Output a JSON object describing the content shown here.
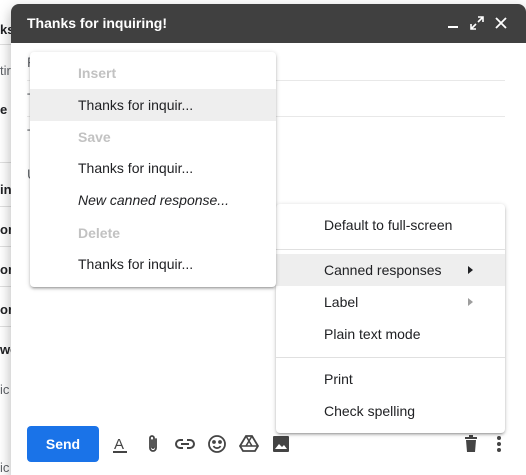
{
  "background": {
    "fragments": [
      "ks",
      "tir",
      "e",
      "in",
      "on",
      "on",
      "on",
      "we",
      "ic",
      "ic"
    ]
  },
  "compose": {
    "title": "Thanks for inquiring!",
    "field_fragments": [
      "F",
      "T",
      "T",
      "U"
    ],
    "send_label": "Send"
  },
  "canned_menu": {
    "insert_header": "Insert",
    "insert_item": "Thanks for inquir...",
    "save_header": "Save",
    "save_item": "Thanks for inquir...",
    "new_response": "New canned response...",
    "delete_header": "Delete",
    "delete_item": "Thanks for inquir..."
  },
  "more_menu": {
    "items": [
      "Default to full-screen",
      "Canned responses",
      "Label",
      "Plain text mode",
      "Print",
      "Check spelling"
    ]
  },
  "colors": {
    "header_bg": "#404040",
    "send_button": "#1a73e8",
    "highlight": "#eeeeee",
    "disabled_header": "#c2c2c2"
  }
}
